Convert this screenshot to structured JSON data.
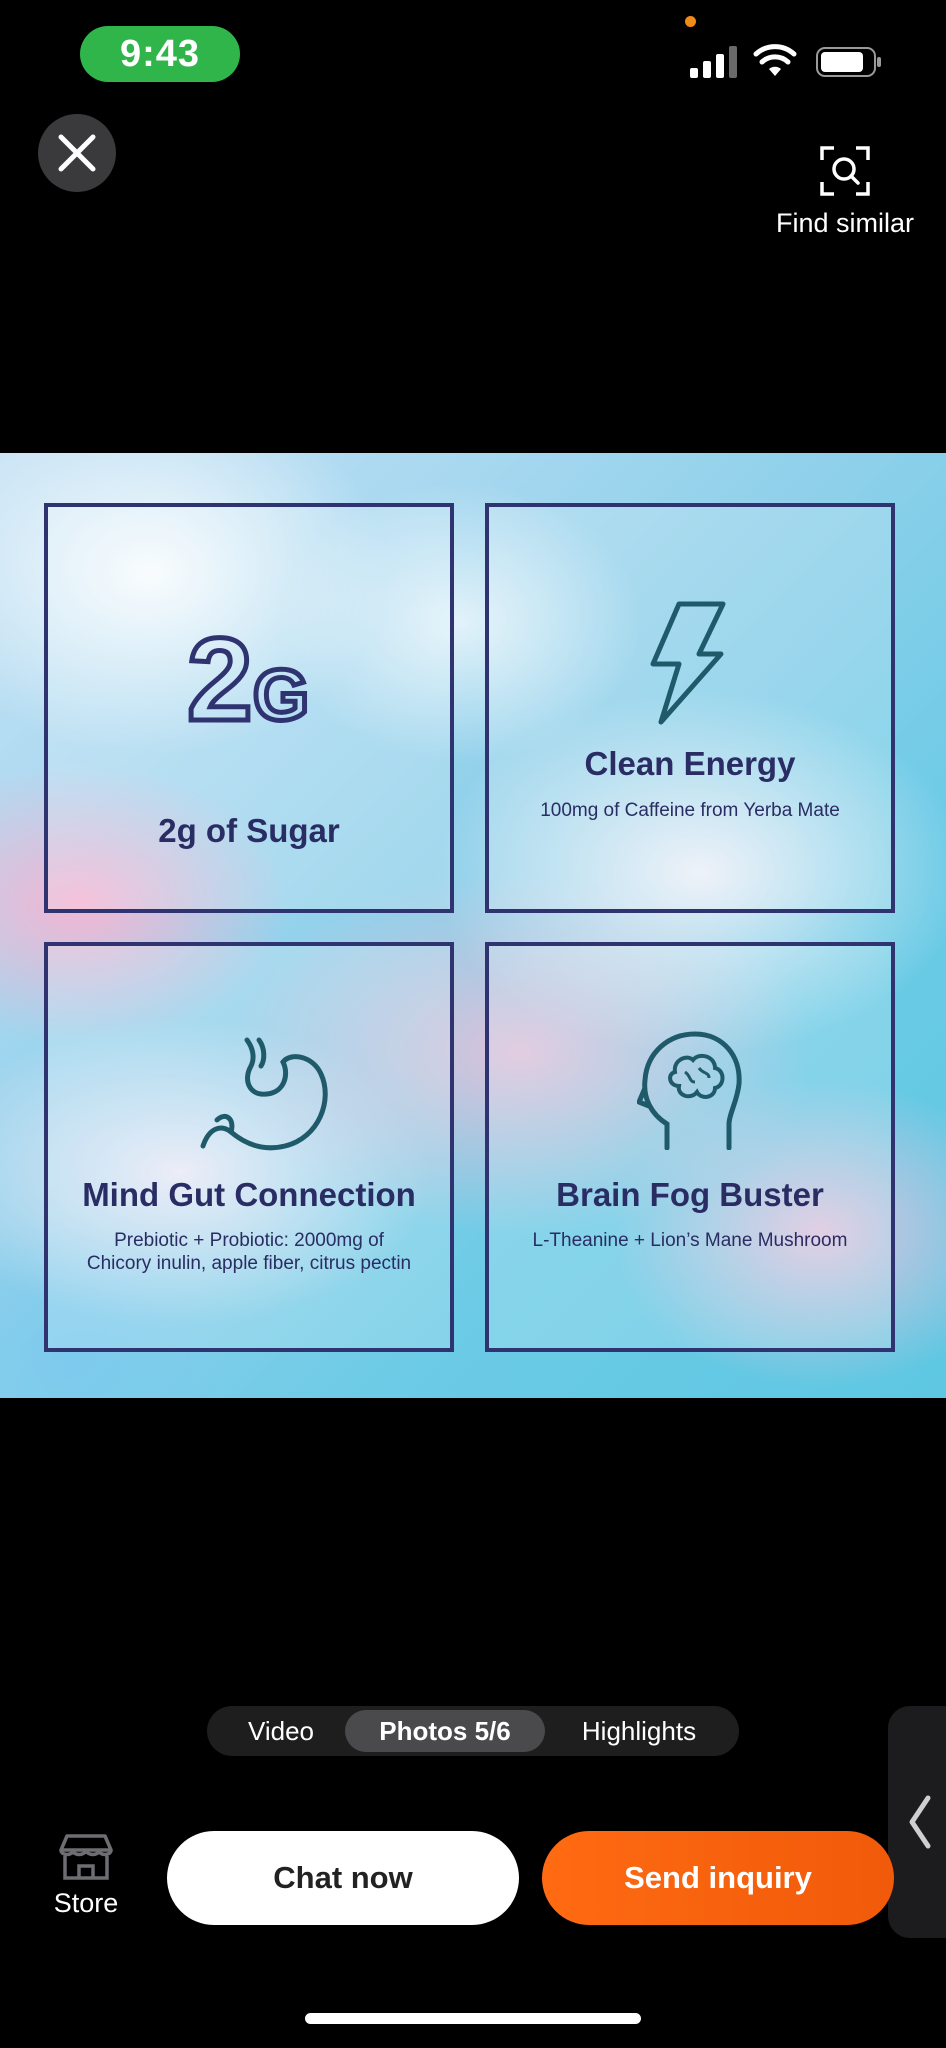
{
  "status_bar": {
    "time": "9:43",
    "signal_icon": "cellular-signal-icon",
    "wifi_icon": "wifi-icon",
    "battery_icon": "battery-icon"
  },
  "header": {
    "close_icon": "close-icon",
    "find_similar_label": "Find similar",
    "find_similar_icon": "image-search-icon"
  },
  "product_image": {
    "tiles": [
      {
        "icon": "2g-icon",
        "title": "2g of Sugar",
        "subtitle": ""
      },
      {
        "icon": "lightning-bolt-icon",
        "title": "Clean Energy",
        "subtitle": "100mg of Caffeine from Yerba Mate"
      },
      {
        "icon": "stomach-icon",
        "title": "Mind Gut Connection",
        "subtitle_line1": "Prebiotic + Probiotic: 2000mg of",
        "subtitle_line2": "Chicory inulin, apple fiber, citrus pectin"
      },
      {
        "icon": "brain-head-icon",
        "title": "Brain Fog Buster",
        "subtitle": "L-Theanine + Lion’s Mane Mushroom"
      }
    ],
    "colors": {
      "tile_border": "#2f3370",
      "icon_stroke": "#1f5a6b",
      "title_text": "#2a2d63"
    }
  },
  "media_tabs": {
    "items": [
      {
        "label": "Video",
        "active": false
      },
      {
        "label": "Photos 5/6",
        "active": true
      },
      {
        "label": "Highlights",
        "active": false
      }
    ]
  },
  "side_handle": {
    "icon": "chevron-left-icon"
  },
  "bottom_bar": {
    "store_label": "Store",
    "store_icon": "storefront-icon",
    "chat_label": "Chat now",
    "inquiry_label": "Send inquiry",
    "inquiry_color": "#ff6a12"
  }
}
